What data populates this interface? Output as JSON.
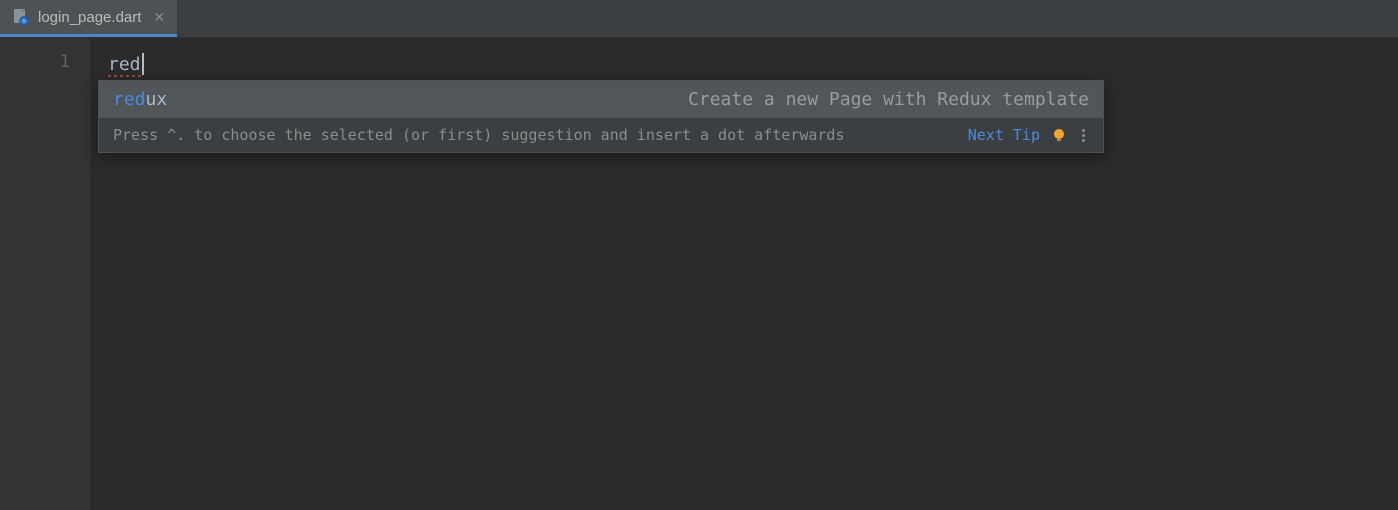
{
  "tab": {
    "filename": "login_page.dart"
  },
  "editor": {
    "line_number": "1",
    "typed_text": "red"
  },
  "autocomplete": {
    "suggestion": {
      "match": "red",
      "rest": "ux",
      "description": "Create a new Page with Redux template"
    },
    "tip": {
      "text": "Press ^. to choose the selected (or first) suggestion and insert a dot afterwards",
      "next_label": "Next Tip"
    }
  }
}
